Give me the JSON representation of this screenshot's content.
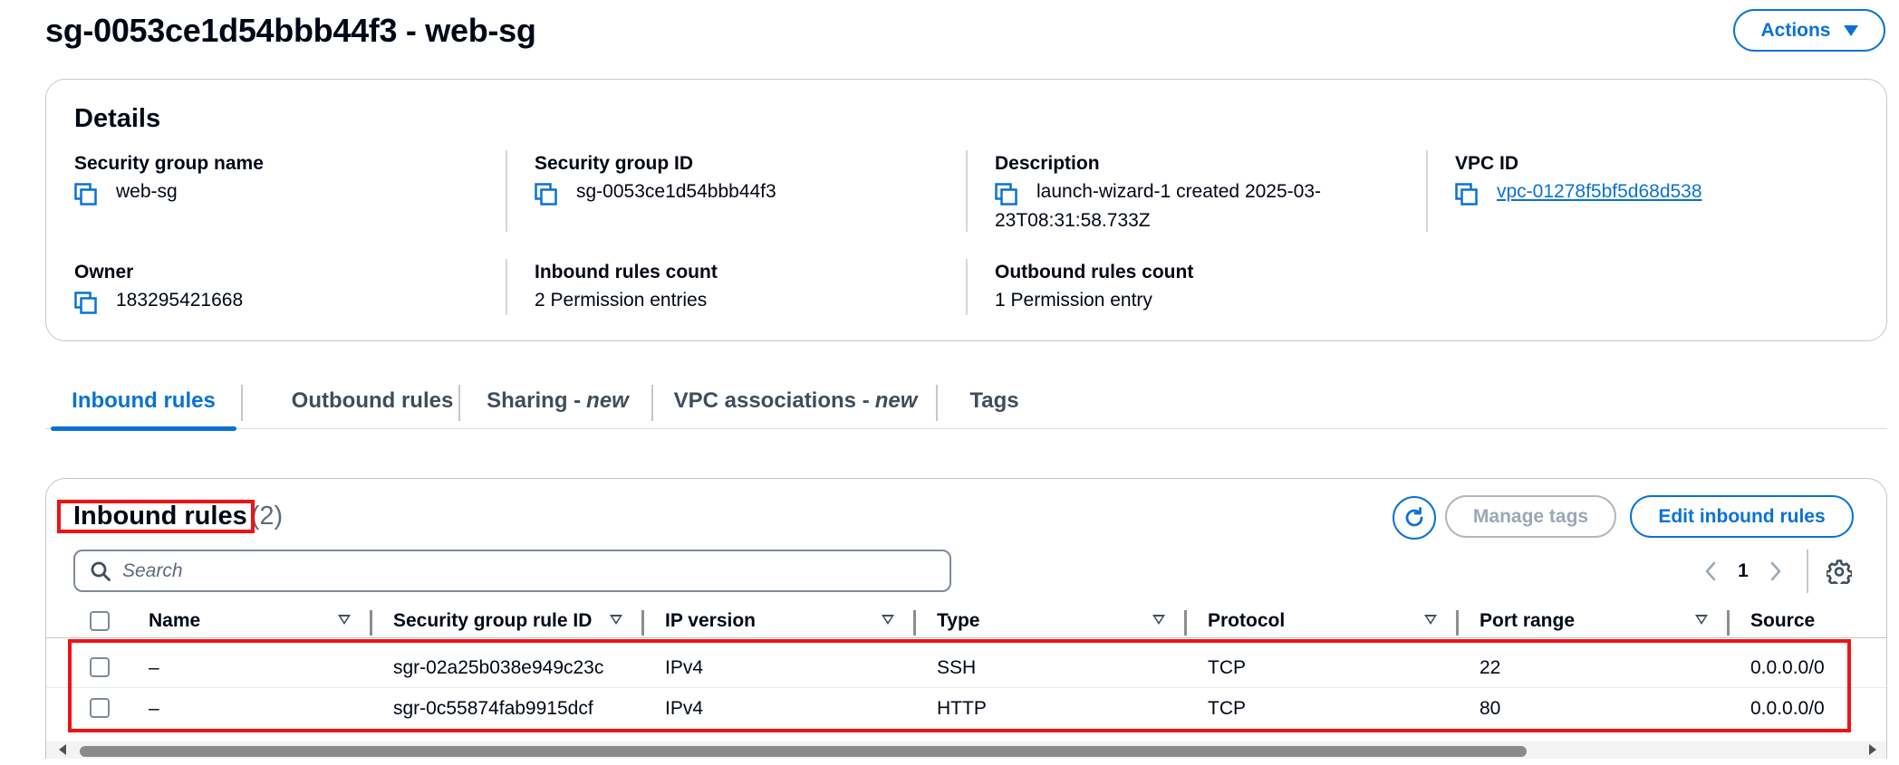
{
  "header": {
    "title": "sg-0053ce1d54bbb44f3 - web-sg",
    "actions_label": "Actions"
  },
  "details": {
    "title": "Details",
    "fields": {
      "sg_name": {
        "label": "Security group name",
        "value": "web-sg"
      },
      "sg_id": {
        "label": "Security group ID",
        "value": "sg-0053ce1d54bbb44f3"
      },
      "description": {
        "label": "Description",
        "value_line1": "launch-wizard-1 created 2025-03-",
        "value_line2": "23T08:31:58.733Z"
      },
      "vpc_id": {
        "label": "VPC ID",
        "value": "vpc-01278f5bf5d68d538"
      },
      "owner": {
        "label": "Owner",
        "value": "183295421668"
      },
      "inbound_count": {
        "label": "Inbound rules count",
        "value": "2 Permission entries"
      },
      "outbound_count": {
        "label": "Outbound rules count",
        "value": "1 Permission entry"
      }
    }
  },
  "tabs": [
    {
      "label": "Inbound rules",
      "suffix": "",
      "active": true
    },
    {
      "label": "Outbound rules",
      "suffix": "",
      "active": false
    },
    {
      "label": "Sharing -",
      "suffix": "new",
      "active": false
    },
    {
      "label": "VPC associations -",
      "suffix": "new",
      "active": false
    },
    {
      "label": "Tags",
      "suffix": "",
      "active": false
    }
  ],
  "rules_panel": {
    "title": "Inbound rules",
    "count": "(2)",
    "manage_tags_label": "Manage tags",
    "edit_label": "Edit inbound rules",
    "search_placeholder": "Search",
    "current_page": "1",
    "columns": [
      "Name",
      "Security group rule ID",
      "IP version",
      "Type",
      "Protocol",
      "Port range",
      "Source"
    ],
    "rows": [
      {
        "name": "–",
        "rule_id": "sgr-02a25b038e949c23c",
        "ip_version": "IPv4",
        "type": "SSH",
        "protocol": "TCP",
        "port_range": "22",
        "source": "0.0.0.0/0"
      },
      {
        "name": "–",
        "rule_id": "sgr-0c55874fab9915dcf",
        "ip_version": "IPv4",
        "type": "HTTP",
        "protocol": "TCP",
        "port_range": "80",
        "source": "0.0.0.0/0"
      }
    ]
  },
  "colors": {
    "accent": "#0972d3",
    "highlight_box": "#ef1313",
    "disabled": "#9ba7b6",
    "border": "#c6c6cd"
  },
  "icons": [
    "copy-icon",
    "chevron-down-icon",
    "refresh-icon",
    "search-icon",
    "chevron-left-icon",
    "chevron-right-icon",
    "settings-gear-icon",
    "sort-down-icon"
  ]
}
